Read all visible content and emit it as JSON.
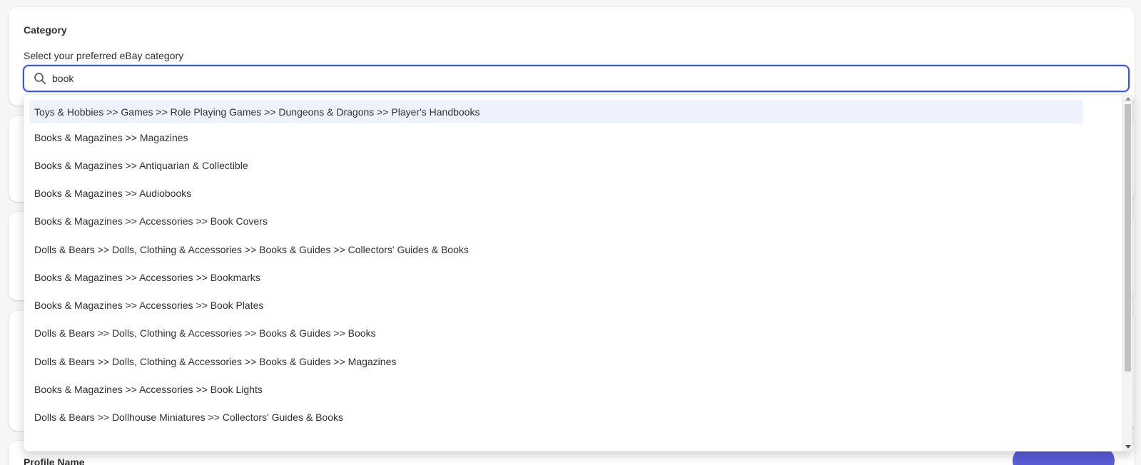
{
  "category_section": {
    "title": "Category",
    "field_label": "Select your preferred eBay category",
    "search": {
      "value": "book",
      "icon": "search-icon"
    }
  },
  "dropdown": {
    "options": [
      "Toys & Hobbies >> Games >> Role Playing Games >> Dungeons & Dragons >> Player's Handbooks",
      "Books & Magazines >> Magazines",
      "Books & Magazines >> Antiquarian & Collectible",
      "Books & Magazines >> Audiobooks",
      "Books & Magazines >> Accessories >> Book Covers",
      "Dolls & Bears >> Dolls, Clothing & Accessories >> Books & Guides >> Collectors' Guides & Books",
      "Books & Magazines >> Accessories >> Bookmarks",
      "Books & Magazines >> Accessories >> Book Plates",
      "Dolls & Bears >> Dolls, Clothing & Accessories >> Books & Guides >> Books",
      "Dolls & Bears >> Dolls, Clothing & Accessories >> Books & Guides >> Magazines",
      "Books & Magazines >> Accessories >> Book Lights",
      "Dolls & Bears >> Dollhouse Miniatures >> Collectors' Guides & Books"
    ],
    "highlighted_index": 0
  },
  "profile_section": {
    "title": "Profile Name"
  },
  "colors": {
    "accent": "#3a57e8",
    "highlight": "#eef2fd",
    "button": "#5b5bd6",
    "background": "#f6f6f7"
  }
}
